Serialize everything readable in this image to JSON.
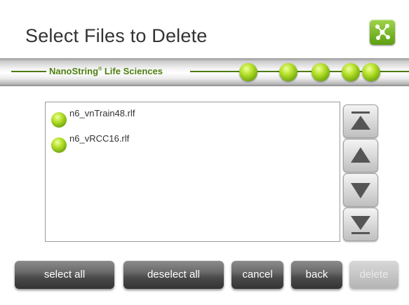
{
  "header": {
    "title": "Select Files to Delete",
    "logo_icon": "network-nodes-icon"
  },
  "banner": {
    "brand": "NanoString",
    "brand_mark": "®",
    "brand_suffix": " Life Sciences",
    "progress_dots": 5,
    "accent_color": "#4e7f0e"
  },
  "file_list": {
    "items": [
      {
        "name": "n6_vnTrain48.rlf",
        "status_icon": "green-status-dot-icon"
      },
      {
        "name": "n6_vRCC16.rlf",
        "status_icon": "green-status-dot-icon"
      }
    ]
  },
  "scroll_controls": {
    "icons": [
      "scroll-to-top-icon",
      "scroll-up-icon",
      "scroll-down-icon",
      "scroll-to-bottom-icon"
    ]
  },
  "buttons": {
    "select_all": "select all",
    "deselect_all": "deselect all",
    "cancel": "cancel",
    "back": "back",
    "delete": "delete",
    "delete_enabled": false
  }
}
